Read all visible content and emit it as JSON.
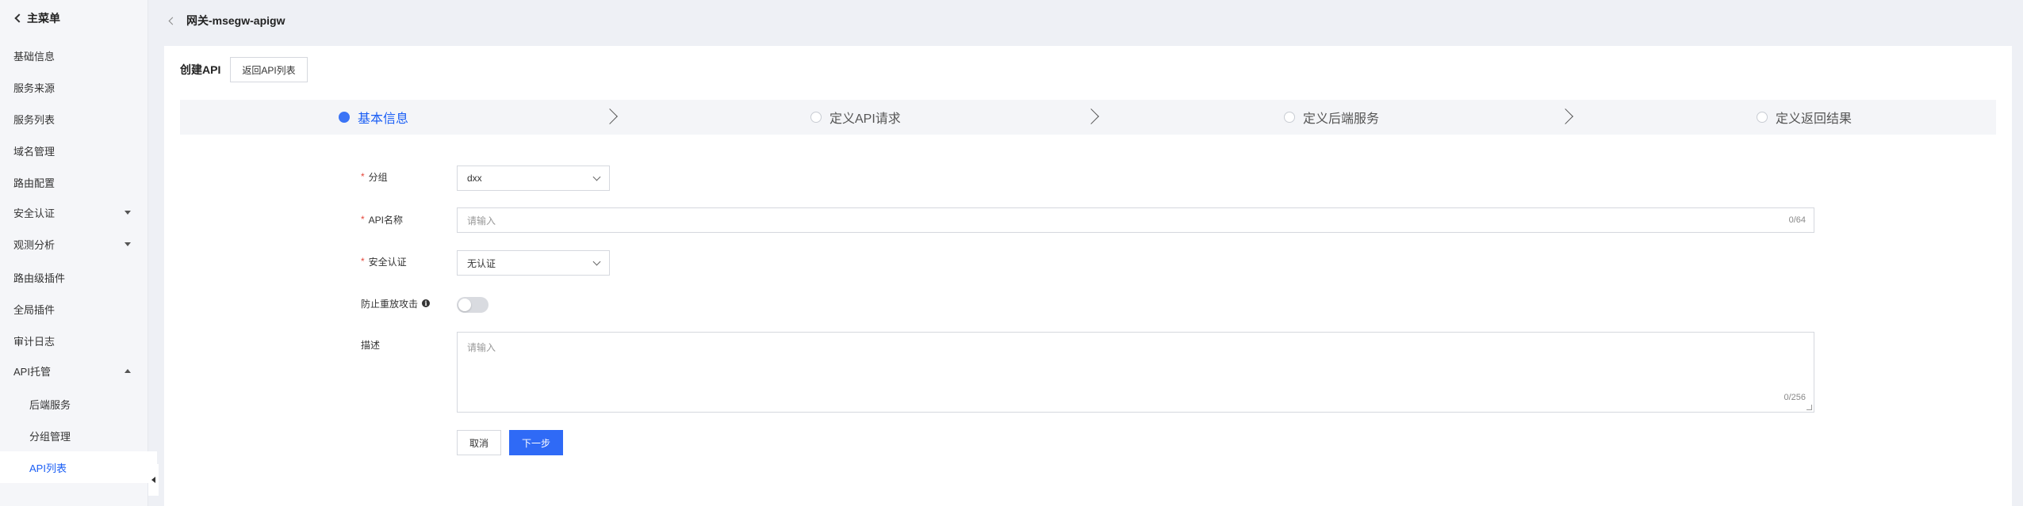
{
  "sidebar": {
    "title": "主菜单",
    "items": [
      {
        "label": "基础信息"
      },
      {
        "label": "服务来源"
      },
      {
        "label": "服务列表"
      },
      {
        "label": "域名管理"
      },
      {
        "label": "路由配置"
      },
      {
        "label": "安全认证"
      },
      {
        "label": "观测分析"
      },
      {
        "label": "路由级插件"
      },
      {
        "label": "全局插件"
      },
      {
        "label": "审计日志"
      },
      {
        "label": "API托管"
      },
      {
        "label": "后端服务"
      },
      {
        "label": "分组管理"
      },
      {
        "label": "API列表"
      }
    ]
  },
  "header": {
    "title": "网关-msegw-apigw"
  },
  "card": {
    "title": "创建API",
    "return_label": "返回API列表"
  },
  "steps": [
    {
      "label": "基本信息"
    },
    {
      "label": "定义API请求"
    },
    {
      "label": "定义后端服务"
    },
    {
      "label": "定义返回结果"
    }
  ],
  "form": {
    "group_label": "分组",
    "group_value": "dxx",
    "name_label": "API名称",
    "name_placeholder": "请输入",
    "name_counter": "0/64",
    "auth_label": "安全认证",
    "auth_value": "无认证",
    "replay_label": "防止重放攻击",
    "replay_enabled": false,
    "desc_label": "描述",
    "desc_placeholder": "请输入",
    "desc_counter": "0/256",
    "info_glyph": "i"
  },
  "actions": {
    "cancel_label": "取消",
    "next_label": "下一步"
  },
  "colors": {
    "accent": "#2f6af6",
    "required": "#e5473b",
    "background": "#eef0f5"
  }
}
